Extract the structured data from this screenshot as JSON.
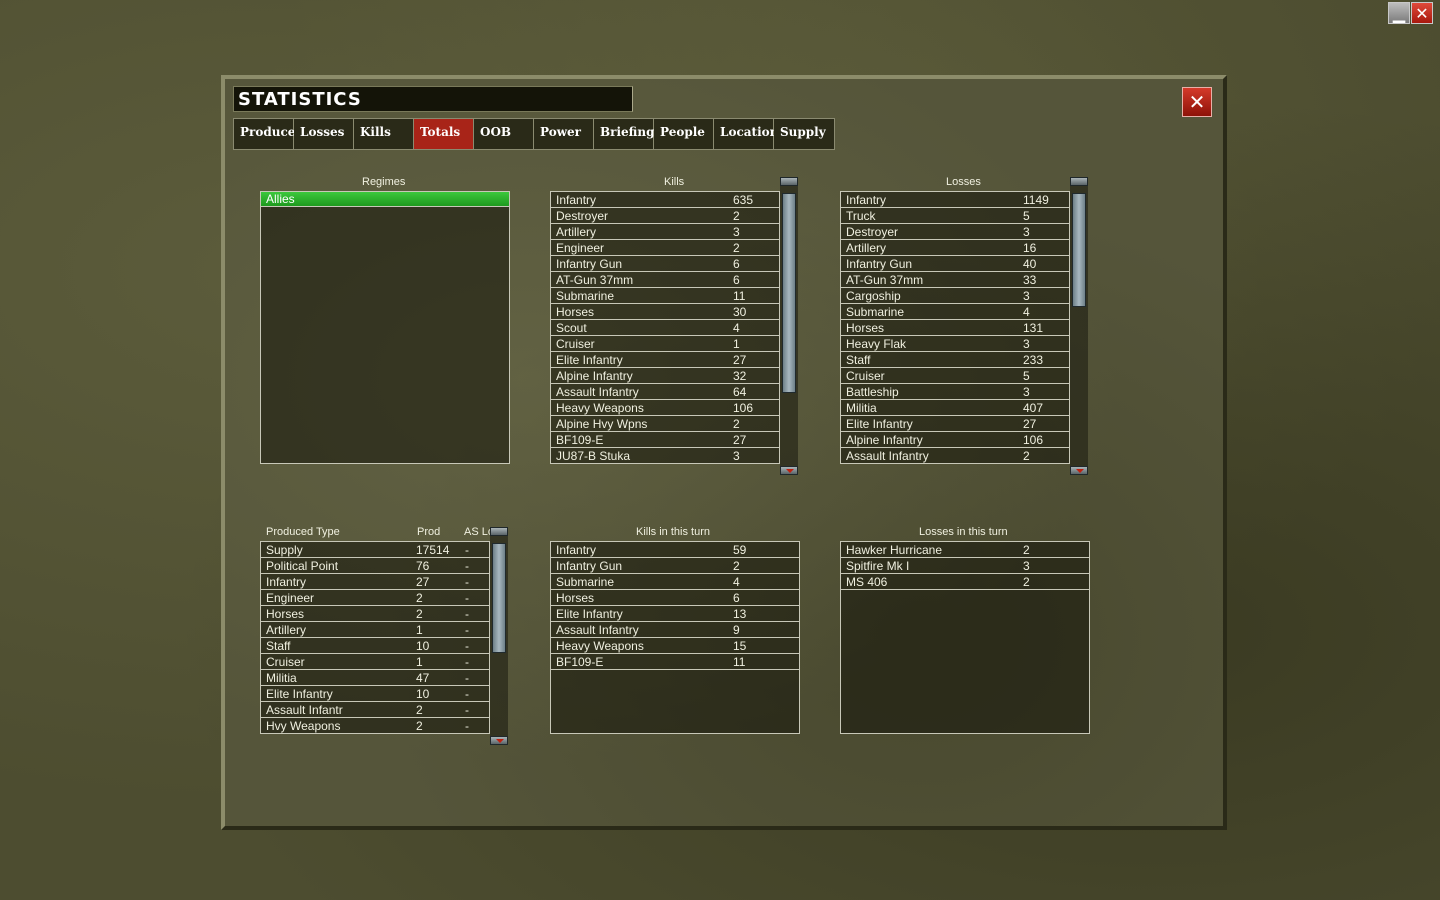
{
  "title": "STATISTICS",
  "tabs": [
    "Produce",
    "Losses",
    "Kills",
    "Totals",
    "OOB",
    "Power",
    "Briefing",
    "People",
    "Location",
    "Supply"
  ],
  "active_tab": "Totals",
  "regimes": {
    "header": "Regimes",
    "items": [
      "Allies"
    ]
  },
  "kills": {
    "header": "Kills",
    "rows": [
      [
        "Infantry",
        "635"
      ],
      [
        "Destroyer",
        "2"
      ],
      [
        "Artillery",
        "3"
      ],
      [
        "Engineer",
        "2"
      ],
      [
        "Infantry Gun",
        "6"
      ],
      [
        "AT-Gun 37mm",
        "6"
      ],
      [
        "Submarine",
        "11"
      ],
      [
        "Horses",
        "30"
      ],
      [
        "Scout",
        "4"
      ],
      [
        "Cruiser",
        "1"
      ],
      [
        "Elite Infantry",
        "27"
      ],
      [
        "Alpine Infantry",
        "32"
      ],
      [
        "Assault Infantry",
        "64"
      ],
      [
        "Heavy Weapons",
        "106"
      ],
      [
        "Alpine Hvy Wpns",
        "2"
      ],
      [
        "BF109-E",
        "27"
      ],
      [
        "JU87-B Stuka",
        "3"
      ]
    ]
  },
  "losses": {
    "header": "Losses",
    "rows": [
      [
        "Infantry",
        "1149"
      ],
      [
        "Truck",
        "5"
      ],
      [
        "Destroyer",
        "3"
      ],
      [
        "Artillery",
        "16"
      ],
      [
        "Infantry Gun",
        "40"
      ],
      [
        "AT-Gun 37mm",
        "33"
      ],
      [
        "Cargoship",
        "3"
      ],
      [
        "Submarine",
        "4"
      ],
      [
        "Horses",
        "131"
      ],
      [
        "Heavy Flak",
        "3"
      ],
      [
        "Staff",
        "233"
      ],
      [
        "Cruiser",
        "5"
      ],
      [
        "Battleship",
        "3"
      ],
      [
        "Militia",
        "407"
      ],
      [
        "Elite Infantry",
        "27"
      ],
      [
        "Alpine Infantry",
        "106"
      ],
      [
        "Assault Infantry",
        "2"
      ]
    ]
  },
  "produced": {
    "header_type": "Produced Type",
    "header_prod": "Prod",
    "header_as": "AS Lo",
    "rows": [
      [
        "Supply",
        "17514",
        "-"
      ],
      [
        "Political Point",
        "76",
        "-"
      ],
      [
        "Infantry",
        "27",
        "-"
      ],
      [
        "Engineer",
        "2",
        "-"
      ],
      [
        "Horses",
        "2",
        "-"
      ],
      [
        "Artillery",
        "1",
        "-"
      ],
      [
        "Staff",
        "10",
        "-"
      ],
      [
        "Cruiser",
        "1",
        "-"
      ],
      [
        "Militia",
        "47",
        "-"
      ],
      [
        "Elite Infantry",
        "10",
        "-"
      ],
      [
        "Assault Infantr",
        "2",
        "-"
      ],
      [
        "Hvy Weapons",
        "2",
        "-"
      ]
    ]
  },
  "kills_turn": {
    "header": "Kills in this turn",
    "rows": [
      [
        "Infantry",
        "59"
      ],
      [
        "Infantry Gun",
        "2"
      ],
      [
        "Submarine",
        "4"
      ],
      [
        "Horses",
        "6"
      ],
      [
        "Elite Infantry",
        "13"
      ],
      [
        "Assault Infantry",
        "9"
      ],
      [
        "Heavy Weapons",
        "15"
      ],
      [
        "BF109-E",
        "11"
      ]
    ]
  },
  "losses_turn": {
    "header": "Losses in this turn",
    "rows": [
      [
        "Hawker Hurricane",
        "2"
      ],
      [
        "Spitfire Mk I",
        "3"
      ],
      [
        "MS 406",
        "2"
      ]
    ]
  }
}
